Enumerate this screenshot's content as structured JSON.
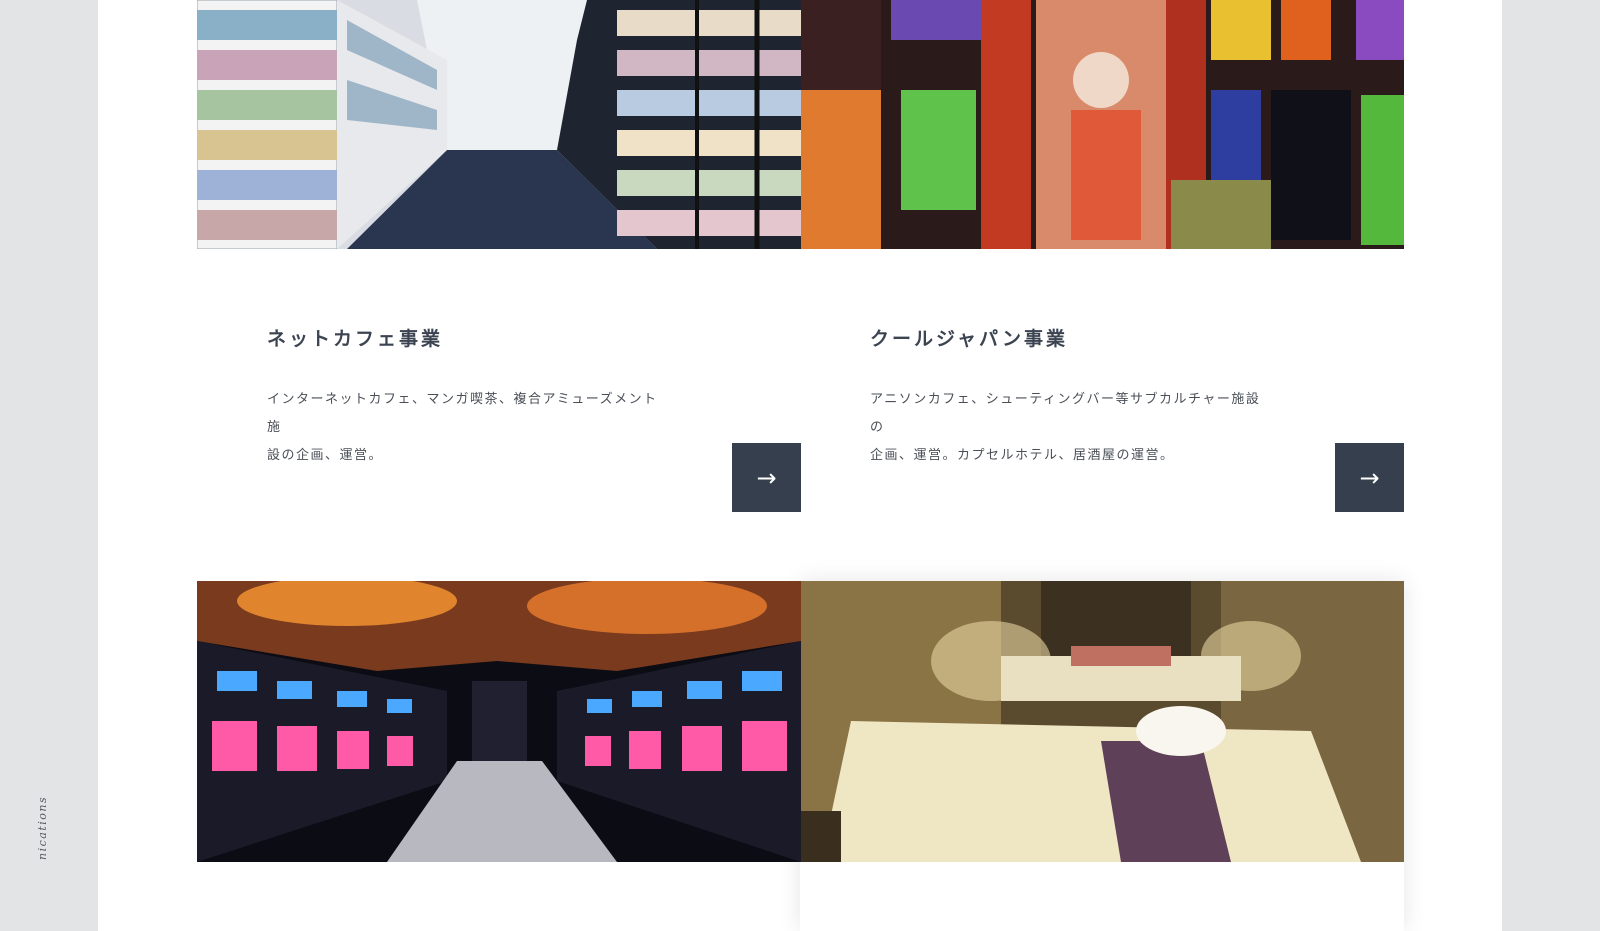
{
  "side_label": "nications",
  "cards": [
    {
      "title": "ネットカフェ事業",
      "description_line1": "インターネットカフェ、マンガ喫茶、複合アミューズメント施",
      "description_line2": "設の企画、運営。",
      "arrow": "→",
      "image_icon": "manga-shelves-photo"
    },
    {
      "title": "クールジャパン事業",
      "description_line1": "アニソンカフェ、シューティングバー等サブカルチャー施設の",
      "description_line2": "企画、運営。カプセルホテル、居酒屋の運営。",
      "arrow": "→",
      "image_icon": "japanese-capsule-photo"
    },
    {
      "image_icon": "pachinko-hall-photo"
    },
    {
      "image_icon": "spa-massage-room-photo"
    }
  ],
  "colors": {
    "background": "#e3e4e6",
    "page": "#ffffff",
    "button": "#353f4d",
    "title": "#3c4452"
  }
}
